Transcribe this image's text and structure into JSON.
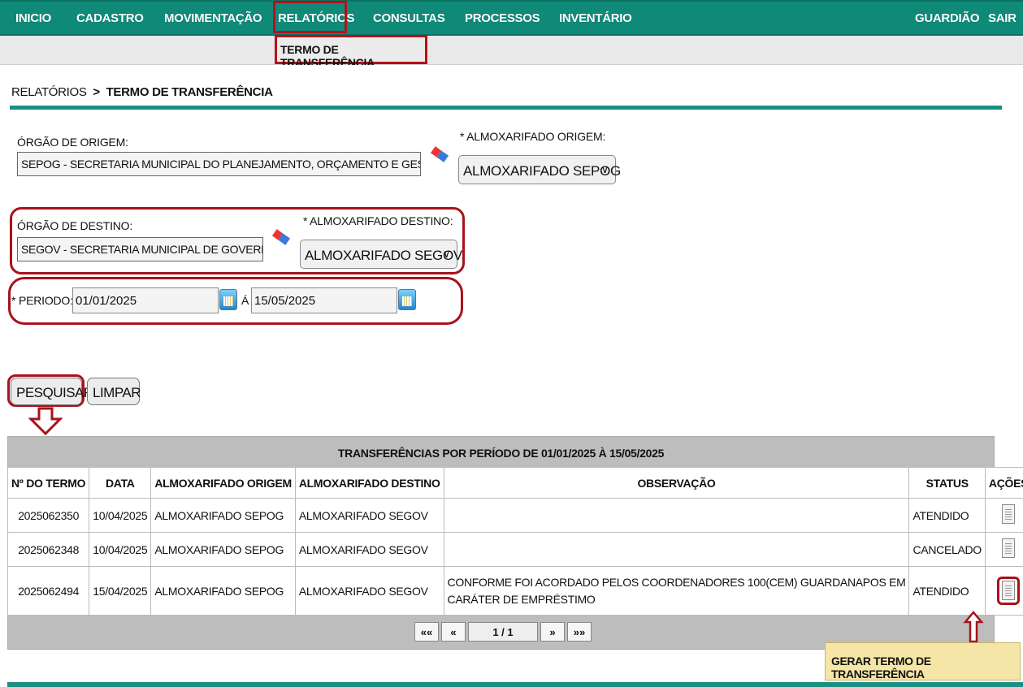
{
  "nav": {
    "left": [
      "INICIO",
      "CADASTRO",
      "MOVIMENTAÇÃO",
      "RELATÓRIOS",
      "CONSULTAS",
      "PROCESSOS",
      "INVENTÁRIO"
    ],
    "right": [
      "GUARDIÃO",
      "SAIR"
    ],
    "submenu": "TERMO DE TRANSFERÊNCIA",
    "color": "#0f8a78"
  },
  "breadcrumb": {
    "parent": "RELATÓRIOS",
    "separator": ">",
    "current": "TERMO DE TRANSFERÊNCIA"
  },
  "form": {
    "orgao_origem_label": "ÓRGÃO DE ORIGEM:",
    "orgao_origem_value": "SEPOG - SECRETARIA MUNICIPAL DO PLANEJAMENTO, ORÇAMENTO E GESTÃO",
    "almox_origem_label": "* ALMOXARIFADO ORIGEM:",
    "almox_origem_value": "ALMOXARIFADO SEPOG",
    "orgao_destino_label": "ÓRGÃO DE DESTINO:",
    "orgao_destino_value": "SEGOV - SECRETARIA MUNICIPAL DE GOVERNO",
    "almox_destino_label": "* ALMOXARIFADO DESTINO:",
    "almox_destino_value": "ALMOXARIFADO SEGOV",
    "periodo_label": "* PERIODO:",
    "periodo_inicio": "01/01/2025",
    "periodo_sep": "Á",
    "periodo_fim": "15/05/2025",
    "btn_pesquisar": "PESQUISAR",
    "btn_limpar": "LIMPAR"
  },
  "table": {
    "title": "TRANSFERÊNCIAS POR PERÍODO DE 01/01/2025 À 15/05/2025",
    "headers": [
      "Nº DO TERMO",
      "DATA",
      "ALMOXARIFADO ORIGEM",
      "ALMOXARIFADO DESTINO",
      "OBSERVAÇÃO",
      "STATUS",
      "AÇÕES"
    ],
    "rows": [
      {
        "termo": "2025062350",
        "data": "10/04/2025",
        "origem": "ALMOXARIFADO SEPOG",
        "destino": "ALMOXARIFADO SEGOV",
        "obs1": "",
        "obs2": "",
        "status": "ATENDIDO"
      },
      {
        "termo": "2025062348",
        "data": "10/04/2025",
        "origem": "ALMOXARIFADO SEPOG",
        "destino": "ALMOXARIFADO SEGOV",
        "obs1": "",
        "obs2": "",
        "status": "CANCELADO"
      },
      {
        "termo": "2025062494",
        "data": "15/04/2025",
        "origem": "ALMOXARIFADO SEPOG",
        "destino": "ALMOXARIFADO SEGOV",
        "obs1": "CONFORME FOI ACORDADO PELOS COORDENADORES 100(CEM) GUARDANAPOS EM",
        "obs2": "CARÁTER DE EMPRÉSTIMO",
        "status": "ATENDIDO"
      }
    ]
  },
  "pager": {
    "first": "««",
    "prev": "«",
    "page": "1 / 1",
    "next": "»",
    "last": "»»"
  },
  "tooltip": "GERAR TERMO DE TRANSFERÊNCIA",
  "highlight_color": "#a8121b"
}
